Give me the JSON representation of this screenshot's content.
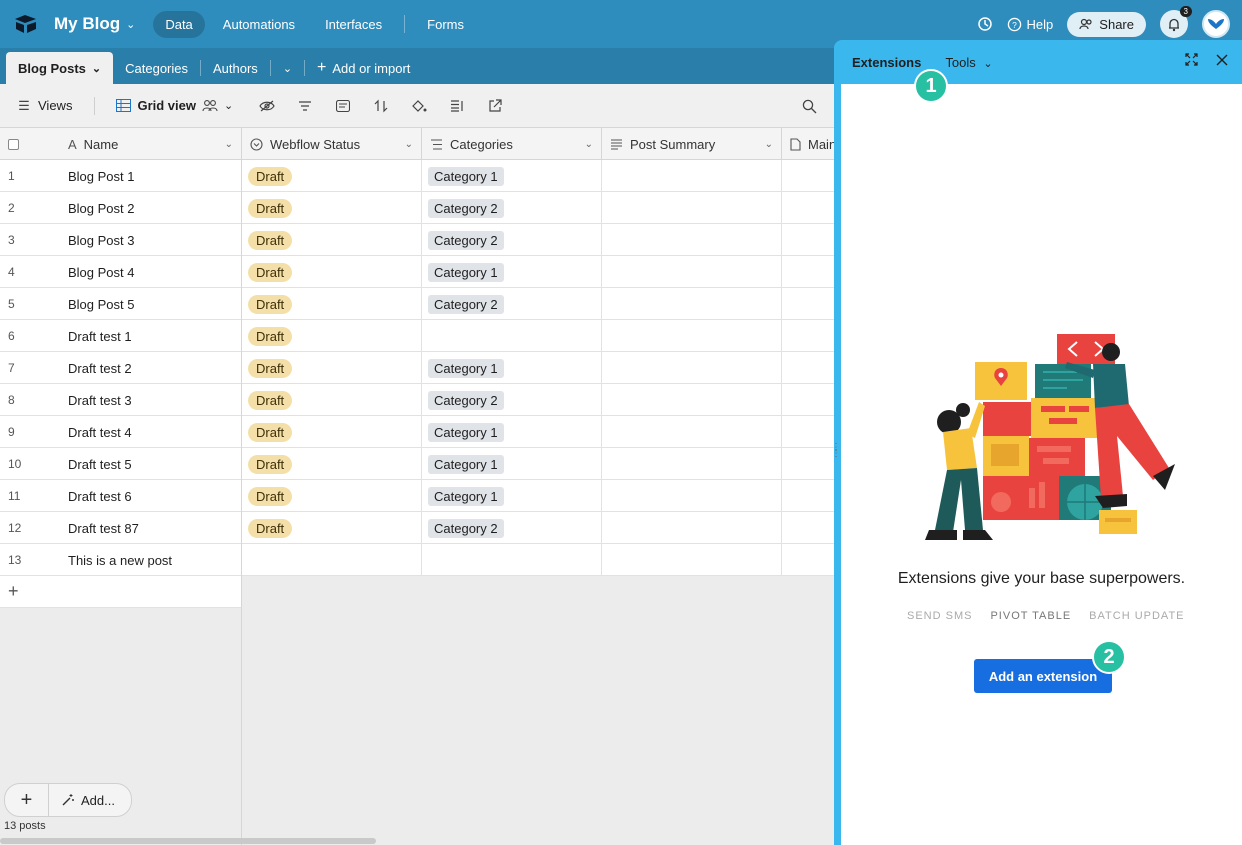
{
  "header": {
    "base_name": "My Blog",
    "nav": [
      "Data",
      "Automations",
      "Interfaces",
      "Forms"
    ],
    "help_label": "Help",
    "share_label": "Share",
    "notification_count": "3"
  },
  "tables": {
    "items": [
      "Blog Posts",
      "Categories",
      "Authors"
    ],
    "add_label": "Add or import"
  },
  "toolbar": {
    "views_label": "Views",
    "view_name": "Grid view"
  },
  "grid": {
    "columns": [
      "Name",
      "Webflow Status",
      "Categories",
      "Post Summary",
      "Main"
    ],
    "rows": [
      {
        "num": "1",
        "name": "Blog Post 1",
        "status": "Draft",
        "category": "Category 1"
      },
      {
        "num": "2",
        "name": "Blog Post 2",
        "status": "Draft",
        "category": "Category 2"
      },
      {
        "num": "3",
        "name": "Blog Post 3",
        "status": "Draft",
        "category": "Category 2"
      },
      {
        "num": "4",
        "name": "Blog Post 4",
        "status": "Draft",
        "category": "Category 1"
      },
      {
        "num": "5",
        "name": "Blog Post 5",
        "status": "Draft",
        "category": "Category 2"
      },
      {
        "num": "6",
        "name": "Draft test 1",
        "status": "Draft",
        "category": ""
      },
      {
        "num": "7",
        "name": "Draft test 2",
        "status": "Draft",
        "category": "Category 1"
      },
      {
        "num": "8",
        "name": "Draft test 3",
        "status": "Draft",
        "category": "Category 2"
      },
      {
        "num": "9",
        "name": "Draft test 4",
        "status": "Draft",
        "category": "Category 1"
      },
      {
        "num": "10",
        "name": "Draft test 5",
        "status": "Draft",
        "category": "Category 1"
      },
      {
        "num": "11",
        "name": "Draft test 6",
        "status": "Draft",
        "category": "Category 1"
      },
      {
        "num": "12",
        "name": "Draft test 87",
        "status": "Draft",
        "category": "Category 2"
      },
      {
        "num": "13",
        "name": "This is a new post",
        "status": "",
        "category": ""
      }
    ],
    "footer_add_label": "Add...",
    "record_count": "13 posts"
  },
  "panel": {
    "tabs": [
      "Extensions",
      "Tools"
    ],
    "tagline": "Extensions give your base superpowers.",
    "tags": [
      "SEND SMS",
      "PIVOT TABLE",
      "BATCH UPDATE"
    ],
    "button_label": "Add an extension",
    "markers": [
      "1",
      "2"
    ]
  },
  "colors": {
    "header": "#2f8dbd",
    "panel_border": "#3ab8ee",
    "button": "#176ee1",
    "marker": "#28c0a3",
    "draft_pill": "#f4dfa8"
  }
}
